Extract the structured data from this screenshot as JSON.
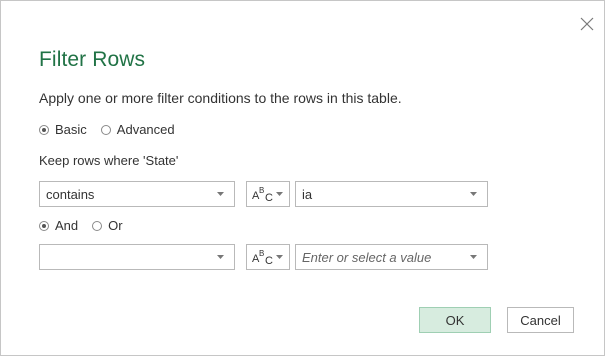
{
  "dialog": {
    "title": "Filter Rows",
    "description": "Apply one or more filter conditions to the rows in this table.",
    "close_icon": "close-icon"
  },
  "mode": {
    "basic_label": "Basic",
    "advanced_label": "Advanced",
    "selected": "Basic"
  },
  "keep_label": "Keep rows where 'State'",
  "condition1": {
    "operator": "contains",
    "type_icon": "abc-type-icon",
    "value": "ia"
  },
  "logic": {
    "and_label": "And",
    "or_label": "Or",
    "selected": "And"
  },
  "condition2": {
    "operator": "",
    "type_icon": "abc-type-icon",
    "value_placeholder": "Enter or select a value"
  },
  "buttons": {
    "ok_label": "OK",
    "cancel_label": "Cancel"
  },
  "colors": {
    "title": "#217346",
    "ok_background": "#d7ecdf",
    "ok_border": "#9fcfb3",
    "border": "#b9b9b9"
  }
}
